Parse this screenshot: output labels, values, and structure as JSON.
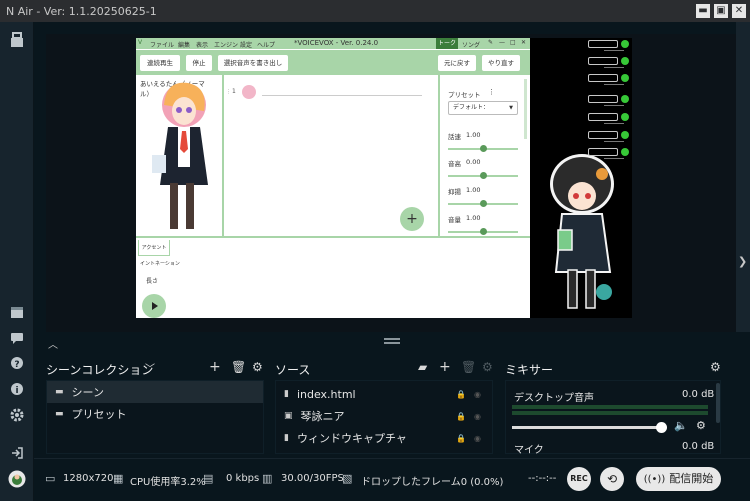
{
  "app": {
    "title": "N Air - Ver: 1.1.20250625-1"
  },
  "window_controls": {
    "minimize": "▬",
    "maximize": "▣",
    "close": "✕"
  },
  "left_bar": {
    "icons": [
      "studio-icon",
      "clapper-icon",
      "chat-icon",
      "help-icon",
      "info-icon",
      "settings-icon",
      "logout-icon",
      "user-icon"
    ]
  },
  "voicevox": {
    "menu": [
      "ファイル",
      "編集",
      "表示",
      "エンジン",
      "設定",
      "ヘルプ"
    ],
    "title": "*VOICEVOX - Ver. 0.24.0",
    "tabs": [
      "トーク",
      "ソング"
    ],
    "toolbar": [
      "連続再生",
      "停止",
      "選択音声を書き出し"
    ],
    "undo": "元に戻す",
    "redo": "やり直す",
    "character_name": "あいえるたん（ノーマル）",
    "row_number": "1",
    "preset_label": "プリセット",
    "preset_value": "デフォルト：",
    "params": [
      {
        "label": "話速",
        "value": "1.00",
        "level": 0.5
      },
      {
        "label": "音高",
        "value": "0.00",
        "level": 0.5
      },
      {
        "label": "抑揚",
        "value": "1.00",
        "level": 0.5
      },
      {
        "label": "音量",
        "value": "1.00",
        "level": 0.5
      }
    ],
    "lower_tabs": [
      "アクセント",
      "イントネーション",
      "長さ"
    ],
    "add_button": "+"
  },
  "preview_side": {
    "tag_count": 7
  },
  "scenes": {
    "title": "シーンコレクション",
    "items": [
      {
        "label": "シーン",
        "selected": true
      },
      {
        "label": "プリセット",
        "selected": false
      }
    ]
  },
  "sources": {
    "title": "ソース",
    "items": [
      {
        "label": "index.html"
      },
      {
        "label": "琴詠ニア"
      },
      {
        "label": "ウィンドウキャプチャ"
      }
    ]
  },
  "mixer": {
    "title": "ミキサー",
    "channels": [
      {
        "label": "デスクトップ音声",
        "db": "0.0 dB",
        "level": 0.97
      },
      {
        "label": "マイク",
        "db": "0.0 dB"
      }
    ]
  },
  "footer": {
    "resolution": "1280x720",
    "cpu": "CPU使用率3.2%",
    "bitrate": "0 kbps",
    "fps": "30.00/30FPS",
    "dropped": "ドロップしたフレーム0 (0.0%)",
    "timer": "--:--:--",
    "rec": "REC",
    "stream_button": "配信開始"
  },
  "colors": {
    "accent_green": "#a8d5a8",
    "panel": "#0a151c",
    "selected_row": "#1f2b33"
  }
}
